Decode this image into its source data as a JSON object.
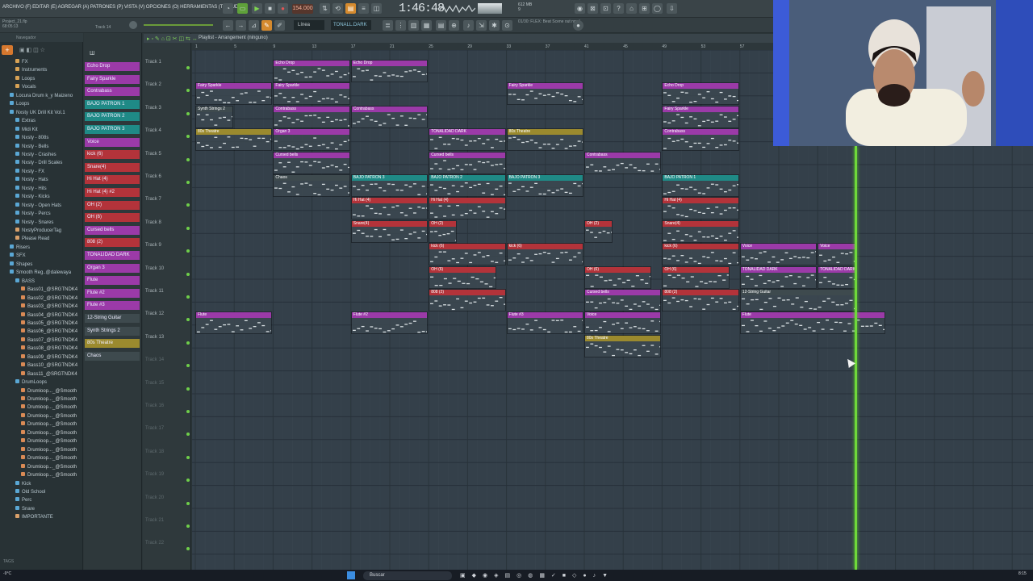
{
  "menu": {
    "text": "ARCHIVO (F) EDITAR (E) AGREGAR (A) PATRONES (P) VISTA (V) OPCIONES (O) HERRAMIENTAS (T) AYUDA"
  },
  "transport": {
    "tempo": "154.000",
    "time": "1:46:48"
  },
  "project": {
    "name": "Project_21.flp",
    "time": "68:05:13",
    "track": "Track 14"
  },
  "toolbar": {
    "pattern": "TONALL.DARK",
    "snap": "Línea",
    "hint": "01/30: FLEX: Beat Scene out now!",
    "mem": "612 MB",
    "poly": "9",
    "cpu": "0"
  },
  "playlist": {
    "title": "Playlist - Arrangement",
    "pattern_sel": "(ninguno)"
  },
  "ruler_labels": [
    "1",
    "5",
    "9",
    "13",
    "17",
    "21",
    "25",
    "29",
    "33",
    "37",
    "41",
    "45",
    "49",
    "53",
    "57",
    "61"
  ],
  "browser": {
    "tabs_label": "Navegador",
    "items": [
      {
        "label": "FX",
        "color": "#d7a255",
        "indent": 1
      },
      {
        "label": "Instruments",
        "color": "#d7a255",
        "indent": 1
      },
      {
        "label": "Loops",
        "color": "#d7a255",
        "indent": 1
      },
      {
        "label": "Vocals",
        "color": "#d7a255",
        "indent": 1
      },
      {
        "label": "Locura Drum k_y Maizeno",
        "color": "#5aa7d4",
        "indent": 0
      },
      {
        "label": "Loops",
        "color": "#5aa7d4",
        "indent": 0
      },
      {
        "label": "Nxsty UK Drill Kit Vol.1",
        "color": "#5aa7d4",
        "indent": 0
      },
      {
        "label": "Extras",
        "color": "#5aa7d4",
        "indent": 1
      },
      {
        "label": "Midi Kit",
        "color": "#5aa7d4",
        "indent": 1
      },
      {
        "label": "Nxsty - 808s",
        "color": "#5aa7d4",
        "indent": 1
      },
      {
        "label": "Nxsty - Bells",
        "color": "#5aa7d4",
        "indent": 1
      },
      {
        "label": "Nxsty - Crashes",
        "color": "#5aa7d4",
        "indent": 1
      },
      {
        "label": "Nxsty - Drill Scales",
        "color": "#5aa7d4",
        "indent": 1
      },
      {
        "label": "Nxsty - FX",
        "color": "#5aa7d4",
        "indent": 1
      },
      {
        "label": "Nxsty - Hats",
        "color": "#5aa7d4",
        "indent": 1
      },
      {
        "label": "Nxsty - Hits",
        "color": "#5aa7d4",
        "indent": 1
      },
      {
        "label": "Nxsty - Kicks",
        "color": "#5aa7d4",
        "indent": 1
      },
      {
        "label": "Nxsty - Open Hats",
        "color": "#5aa7d4",
        "indent": 1
      },
      {
        "label": "Nxsty - Percs",
        "color": "#5aa7d4",
        "indent": 1
      },
      {
        "label": "Nxsty - Snares",
        "color": "#5aa7d4",
        "indent": 1
      },
      {
        "label": "NxstyProducerTag",
        "color": "#d9a06a",
        "indent": 1
      },
      {
        "label": "Please Read",
        "color": "#d9a06a",
        "indent": 1
      },
      {
        "label": "Risers",
        "color": "#5aa7d4",
        "indent": 0
      },
      {
        "label": "SFX",
        "color": "#5aa7d4",
        "indent": 0
      },
      {
        "label": "Shapes",
        "color": "#5aa7d4",
        "indent": 0
      },
      {
        "label": "Smooth Reg..@dalewaya",
        "color": "#5aa7d4",
        "indent": 0
      },
      {
        "label": "BASS",
        "color": "#5aa7d4",
        "indent": 1
      },
      {
        "label": "Bass01_@SRGTNDK4",
        "color": "#d98a55",
        "indent": 2
      },
      {
        "label": "Bass02_@SRGTNDK4",
        "color": "#d98a55",
        "indent": 2
      },
      {
        "label": "Bass03_@SRGTNDK4",
        "color": "#d98a55",
        "indent": 2
      },
      {
        "label": "Bass04_@SRGTNDK4",
        "color": "#d98a55",
        "indent": 2
      },
      {
        "label": "Bass05_@SRGTNDK4",
        "color": "#d98a55",
        "indent": 2
      },
      {
        "label": "Bass06_@SRGTNDK4",
        "color": "#d98a55",
        "indent": 2
      },
      {
        "label": "Bass07_@SRGTNDK4",
        "color": "#d98a55",
        "indent": 2
      },
      {
        "label": "Bass08_@SRGTNDK4",
        "color": "#d98a55",
        "indent": 2
      },
      {
        "label": "Bass09_@SRGTNDK4",
        "color": "#d98a55",
        "indent": 2
      },
      {
        "label": "Bass10_@SRGTNDK4",
        "color": "#d98a55",
        "indent": 2
      },
      {
        "label": "Bass11_@SRGTNDK4",
        "color": "#d98a55",
        "indent": 2
      },
      {
        "label": "DrumLoops",
        "color": "#5aa7d4",
        "indent": 1
      },
      {
        "label": "Drumloop..._@Smooth",
        "color": "#d98a55",
        "indent": 2
      },
      {
        "label": "Drumloop..._@Smooth",
        "color": "#d98a55",
        "indent": 2
      },
      {
        "label": "Drumloop..._@Smooth",
        "color": "#d98a55",
        "indent": 2
      },
      {
        "label": "Drumloop..._@Smooth",
        "color": "#d98a55",
        "indent": 2
      },
      {
        "label": "Drumloop..._@Smooth",
        "color": "#d98a55",
        "indent": 2
      },
      {
        "label": "Drumloop..._@Smooth",
        "color": "#d98a55",
        "indent": 2
      },
      {
        "label": "Drumloop..._@Smooth",
        "color": "#d98a55",
        "indent": 2
      },
      {
        "label": "Drumloop..._@Smooth",
        "color": "#d98a55",
        "indent": 2
      },
      {
        "label": "Drumloop..._@Smooth",
        "color": "#d98a55",
        "indent": 2
      },
      {
        "label": "Drumloop..._@Smooth",
        "color": "#d98a55",
        "indent": 2
      },
      {
        "label": "Drumloop..._@Smooth",
        "color": "#d98a55",
        "indent": 2
      },
      {
        "label": "Kick",
        "color": "#5aa7d4",
        "indent": 1
      },
      {
        "label": "Old School",
        "color": "#5aa7d4",
        "indent": 1
      },
      {
        "label": "Perc",
        "color": "#5aa7d4",
        "indent": 1
      },
      {
        "label": "Snare",
        "color": "#5aa7d4",
        "indent": 1
      },
      {
        "label": "IMPORTANTE",
        "color": "#d9a06a",
        "indent": 1
      }
    ],
    "tags_label": "TAGS"
  },
  "channels": [
    {
      "label": "Echo Drop",
      "color": "#9b3aa8"
    },
    {
      "label": "Fairy Sparkle",
      "color": "#9b3aa8"
    },
    {
      "label": "Contrabass",
      "color": "#9b3aa8"
    },
    {
      "label": "BAJO PATRON 1",
      "color": "#1f8a86"
    },
    {
      "label": "BAJO PATRON 2",
      "color": "#1f8a86"
    },
    {
      "label": "BAJO PATRON 3",
      "color": "#1f8a86"
    },
    {
      "label": "Voice",
      "color": "#9b3aa8"
    },
    {
      "label": "kick (6)",
      "color": "#b3333a"
    },
    {
      "label": "Snare(4)",
      "color": "#b3333a"
    },
    {
      "label": "Hi Hat (4)",
      "color": "#b3333a"
    },
    {
      "label": "Hi Hat (4) #2",
      "color": "#b3333a"
    },
    {
      "label": "OH (2)",
      "color": "#b3333a"
    },
    {
      "label": "OH (6)",
      "color": "#b3333a"
    },
    {
      "label": "Cursed bells",
      "color": "#9b3aa8"
    },
    {
      "label": "808 (2)",
      "color": "#b3333a"
    },
    {
      "label": "TONALIDAD DARK",
      "color": "#9b3aa8"
    },
    {
      "label": "Organ 3",
      "color": "#9b3aa8"
    },
    {
      "label": "Flute",
      "color": "#9b3aa8"
    },
    {
      "label": "Flute #2",
      "color": "#9b3aa8"
    },
    {
      "label": "Flute #3",
      "color": "#9b3aa8"
    },
    {
      "label": "12-String Guitar",
      "color": "#3e4a4e"
    },
    {
      "label": "Synth Strings 2",
      "color": "#3e4a4e"
    },
    {
      "label": "80s Theatre",
      "color": "#9b8a2e"
    },
    {
      "label": "Chaos",
      "color": "#3e4a4e"
    }
  ],
  "tracks": [
    "Track 1",
    "Track 2",
    "Track 3",
    "Track 4",
    "Track 5",
    "Track 6",
    "Track 7",
    "Track 8",
    "Track 9",
    "Track 10",
    "Track 11",
    "Track 12",
    "Track 13",
    "Track 14",
    "Track 15",
    "Track 16",
    "Track 17",
    "Track 18",
    "Track 19",
    "Track 20",
    "Track 21",
    "Track 22"
  ],
  "clips": [
    {
      "label": "Echo Drop",
      "track": 1,
      "start": 9,
      "len": 8,
      "color": "#9b3aa8"
    },
    {
      "label": "Echo Drop",
      "track": 1,
      "start": 17,
      "len": 8,
      "color": "#9b3aa8"
    },
    {
      "label": "Fairy Sparkle",
      "track": 2,
      "start": 1,
      "len": 8,
      "color": "#9b3aa8"
    },
    {
      "label": "Fairy Sparkle",
      "track": 2,
      "start": 9,
      "len": 8,
      "color": "#9b3aa8"
    },
    {
      "label": "Fairy Sparkle",
      "track": 2,
      "start": 33,
      "len": 8,
      "color": "#9b3aa8"
    },
    {
      "label": "Echo Drop",
      "track": 2,
      "start": 49,
      "len": 8,
      "color": "#9b3aa8"
    },
    {
      "label": "Synth Strings 2",
      "track": 3,
      "start": 1,
      "len": 4,
      "color": "#3e4a4e"
    },
    {
      "label": "Contrabass",
      "track": 3,
      "start": 9,
      "len": 8,
      "color": "#9b3aa8"
    },
    {
      "label": "Contrabass",
      "track": 3,
      "start": 17,
      "len": 8,
      "color": "#9b3aa8"
    },
    {
      "label": "Fairy Sparkle",
      "track": 3,
      "start": 49,
      "len": 8,
      "color": "#9b3aa8"
    },
    {
      "label": "80s Theatre",
      "track": 4,
      "start": 1,
      "len": 8,
      "color": "#9b8a2e"
    },
    {
      "label": "Organ 3",
      "track": 4,
      "start": 9,
      "len": 8,
      "color": "#9b3aa8"
    },
    {
      "label": "TONALIDAD DARK",
      "track": 4,
      "start": 25,
      "len": 8,
      "color": "#9b3aa8"
    },
    {
      "label": "80s Theatre",
      "track": 4,
      "start": 33,
      "len": 8,
      "color": "#9b8a2e"
    },
    {
      "label": "Contrabass",
      "track": 4,
      "start": 49,
      "len": 8,
      "color": "#9b3aa8"
    },
    {
      "label": "Cursed bells",
      "track": 5,
      "start": 9,
      "len": 8,
      "color": "#9b3aa8"
    },
    {
      "label": "Cursed bells",
      "track": 5,
      "start": 25,
      "len": 8,
      "color": "#9b3aa8"
    },
    {
      "label": "Contrabass",
      "track": 5,
      "start": 41,
      "len": 8,
      "color": "#9b3aa8"
    },
    {
      "label": "Chaos",
      "track": 6,
      "start": 9,
      "len": 8,
      "color": "#3e4a4e"
    },
    {
      "label": "BAJO PATRON 3",
      "track": 6,
      "start": 17,
      "len": 8,
      "color": "#1f8a86"
    },
    {
      "label": "BAJO PATRON 2",
      "track": 6,
      "start": 25,
      "len": 8,
      "color": "#1f8a86"
    },
    {
      "label": "BAJO PATRON 3",
      "track": 6,
      "start": 33,
      "len": 8,
      "color": "#1f8a86"
    },
    {
      "label": "BAJO PATRON 1",
      "track": 6,
      "start": 49,
      "len": 8,
      "color": "#1f8a86"
    },
    {
      "label": "Hi Hat (4)",
      "track": 7,
      "start": 17,
      "len": 8,
      "color": "#b3333a"
    },
    {
      "label": "Hi Hat (4)",
      "track": 7,
      "start": 25,
      "len": 8,
      "color": "#b3333a"
    },
    {
      "label": "Hi Hat (4)",
      "track": 7,
      "start": 49,
      "len": 8,
      "color": "#b3333a"
    },
    {
      "label": "Snare(4)",
      "track": 8,
      "start": 17,
      "len": 8,
      "color": "#b3333a"
    },
    {
      "label": "OH (2)",
      "track": 8,
      "start": 25,
      "len": 3,
      "color": "#b3333a"
    },
    {
      "label": "OH (2)",
      "track": 8,
      "start": 41,
      "len": 3,
      "color": "#b3333a"
    },
    {
      "label": "Snare(4)",
      "track": 8,
      "start": 49,
      "len": 8,
      "color": "#b3333a"
    },
    {
      "label": "kick (6)",
      "track": 9,
      "start": 25,
      "len": 8,
      "color": "#b3333a"
    },
    {
      "label": "kick (6)",
      "track": 9,
      "start": 33,
      "len": 8,
      "color": "#b3333a"
    },
    {
      "label": "kick (6)",
      "track": 9,
      "start": 49,
      "len": 8,
      "color": "#b3333a"
    },
    {
      "label": "Voice",
      "track": 9,
      "start": 57,
      "len": 8,
      "color": "#9b3aa8"
    },
    {
      "label": "Voice",
      "track": 9,
      "start": 65,
      "len": 4,
      "color": "#9b3aa8"
    },
    {
      "label": "OH (6)",
      "track": 10,
      "start": 25,
      "len": 7,
      "color": "#b3333a"
    },
    {
      "label": "OH (6)",
      "track": 10,
      "start": 41,
      "len": 7,
      "color": "#b3333a"
    },
    {
      "label": "OH (6)",
      "track": 10,
      "start": 49,
      "len": 7,
      "color": "#b3333a"
    },
    {
      "label": "TONALIDAD DARK",
      "track": 10,
      "start": 57,
      "len": 8,
      "color": "#9b3aa8"
    },
    {
      "label": "TONALIDAD DARK",
      "track": 10,
      "start": 65,
      "len": 4,
      "color": "#9b3aa8"
    },
    {
      "label": "808 (2)",
      "track": 11,
      "start": 25,
      "len": 8,
      "color": "#b3333a"
    },
    {
      "label": "Cursed bells",
      "track": 11,
      "start": 41,
      "len": 8,
      "color": "#9b3aa8"
    },
    {
      "label": "808 (2)",
      "track": 11,
      "start": 49,
      "len": 8,
      "color": "#b3333a"
    },
    {
      "label": "12-String Guitar",
      "track": 11,
      "start": 57,
      "len": 12,
      "color": "#3e4a4e"
    },
    {
      "label": "Flute",
      "track": 12,
      "start": 1,
      "len": 8,
      "color": "#9b3aa8"
    },
    {
      "label": "Flute #2",
      "track": 12,
      "start": 17,
      "len": 8,
      "color": "#9b3aa8"
    },
    {
      "label": "Flute #3",
      "track": 12,
      "start": 33,
      "len": 8,
      "color": "#9b3aa8"
    },
    {
      "label": "Voice",
      "track": 12,
      "start": 41,
      "len": 8,
      "color": "#9b3aa8"
    },
    {
      "label": "Flute",
      "track": 12,
      "start": 57,
      "len": 15,
      "color": "#9b3aa8"
    },
    {
      "label": "80s Theatre",
      "track": 13,
      "start": 41,
      "len": 8,
      "color": "#9b8a2e"
    }
  ],
  "taskbar": {
    "search": "Buscar",
    "clock": "8:15",
    "temp": "-9°C"
  }
}
